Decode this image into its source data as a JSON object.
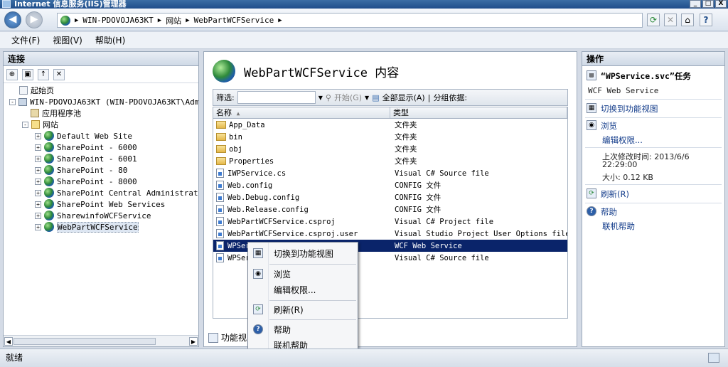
{
  "window": {
    "title": "Internet 信息服务(IIS)管理器",
    "min": "_",
    "max": "□",
    "close": "X"
  },
  "address": {
    "crumbs": [
      "WIN-PDOVOJA63KT",
      "网站",
      "WebPartWCFService"
    ],
    "sep": "▶"
  },
  "toolbar_icons": {
    "refresh": "⟳",
    "stop": "✕",
    "home": "⌂",
    "help": "?"
  },
  "menu": [
    "文件(F)",
    "视图(V)",
    "帮助(H)"
  ],
  "connections": {
    "header": "连接",
    "tree": [
      {
        "label": "起始页",
        "level": 0,
        "expander": ""
      },
      {
        "label": "WIN-PDOVOJA63KT (WIN-PDOVOJA63KT\\Admin",
        "level": 0,
        "expander": "-"
      },
      {
        "label": "应用程序池",
        "level": 1,
        "expander": ""
      },
      {
        "label": "网站",
        "level": 1,
        "expander": "-"
      },
      {
        "label": "Default Web Site",
        "level": 2,
        "expander": "+"
      },
      {
        "label": "SharePoint - 6000",
        "level": 2,
        "expander": "+"
      },
      {
        "label": "SharePoint - 6001",
        "level": 2,
        "expander": "+"
      },
      {
        "label": "SharePoint - 80",
        "level": 2,
        "expander": "+"
      },
      {
        "label": "SharePoint - 8000",
        "level": 2,
        "expander": "+"
      },
      {
        "label": "SharePoint Central Administratio",
        "level": 2,
        "expander": "+"
      },
      {
        "label": "SharePoint Web Services",
        "level": 2,
        "expander": "+"
      },
      {
        "label": "SharewinfoWCFService",
        "level": 2,
        "expander": "+"
      },
      {
        "label": "WebPartWCFService",
        "level": 2,
        "expander": "+",
        "selected": true
      }
    ]
  },
  "content": {
    "title": "WebPartWCFService 内容",
    "filter_label": "筛选:",
    "start_label": "开始(G)",
    "show_all_label": "全部显示(A)",
    "group_label": "分组依据:",
    "columns": [
      "名称",
      "类型"
    ],
    "rows": [
      {
        "name": "App_Data",
        "type": "文件夹",
        "kind": "folder"
      },
      {
        "name": "bin",
        "type": "文件夹",
        "kind": "folder"
      },
      {
        "name": "obj",
        "type": "文件夹",
        "kind": "folder"
      },
      {
        "name": "Properties",
        "type": "文件夹",
        "kind": "folder"
      },
      {
        "name": "IWPService.cs",
        "type": "Visual C# Source file",
        "kind": "file"
      },
      {
        "name": "Web.config",
        "type": "CONFIG 文件",
        "kind": "file"
      },
      {
        "name": "Web.Debug.config",
        "type": "CONFIG 文件",
        "kind": "file"
      },
      {
        "name": "Web.Release.config",
        "type": "CONFIG 文件",
        "kind": "file"
      },
      {
        "name": "WebPartWCFService.csproj",
        "type": "Visual C# Project file",
        "kind": "file"
      },
      {
        "name": "WebPartWCFService.csproj.user",
        "type": "Visual Studio Project User Options file",
        "kind": "file"
      },
      {
        "name": "WPService.svc",
        "type": "WCF Web Service",
        "kind": "file",
        "selected": true
      },
      {
        "name": "WPService.svc.cs",
        "type": "Visual C# Source file",
        "kind": "file"
      }
    ],
    "feature_view_label": "功能视图"
  },
  "actions": {
    "header": "操作",
    "task_title": "“WPService.svc”任务",
    "task_sub": "WCF Web Service",
    "switch_feature": "切换到功能视图",
    "browse": "浏览",
    "edit_perms": "编辑权限...",
    "modified_label": "上次修改时间: 2013/6/6",
    "modified_time": "22:29:00",
    "size": "大小: 0.12 KB",
    "refresh": "刷新(R)",
    "help": "帮助",
    "online_help": "联机帮助"
  },
  "context_menu": {
    "items": [
      "切换到功能视图",
      "浏览",
      "编辑权限...",
      "刷新(R)",
      "帮助",
      "联机帮助"
    ]
  },
  "status": {
    "text": "就绪"
  }
}
